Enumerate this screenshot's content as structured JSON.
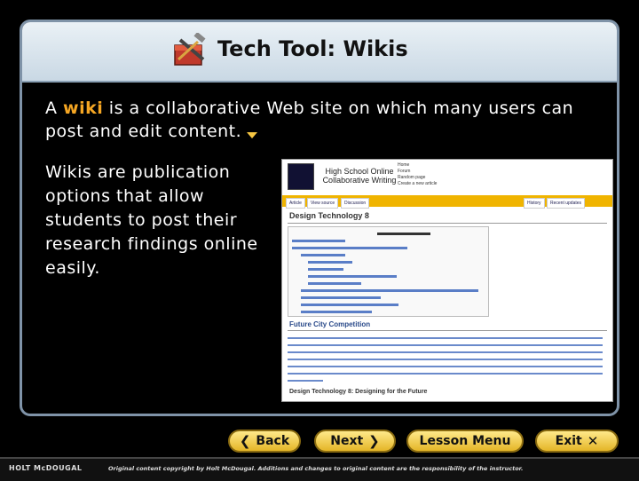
{
  "slide": {
    "title": "Tech Tool: Wikis",
    "intro_pre": "A ",
    "intro_term": "wiki",
    "intro_post": " is a collaborative Web site on which many users can post and edit content.",
    "body": "Wikis are publication options that allow students to post their research findings online easily."
  },
  "screenshot": {
    "site_title": "High School Online Collaborative Writing",
    "nav": [
      "Home",
      "Forum",
      "Random page",
      "Create a new article"
    ],
    "tabs": [
      "Article",
      "View source",
      "Discussion",
      "History",
      "Recent updates"
    ],
    "heading": "Design Technology 8",
    "section": "Future City Competition",
    "subheading": "Design Technology 8: Designing for the Future"
  },
  "nav": {
    "back": "Back",
    "next": "Next",
    "lesson_menu": "Lesson Menu",
    "exit": "Exit"
  },
  "footer": {
    "brand": "HOLT McDOUGAL",
    "copyright": "Original content copyright by Holt McDougal. Additions and changes to original content are the responsibility of the instructor."
  },
  "colors": {
    "accent": "#f5a623",
    "button": "#e4b527",
    "frame": "#7f93a8"
  }
}
